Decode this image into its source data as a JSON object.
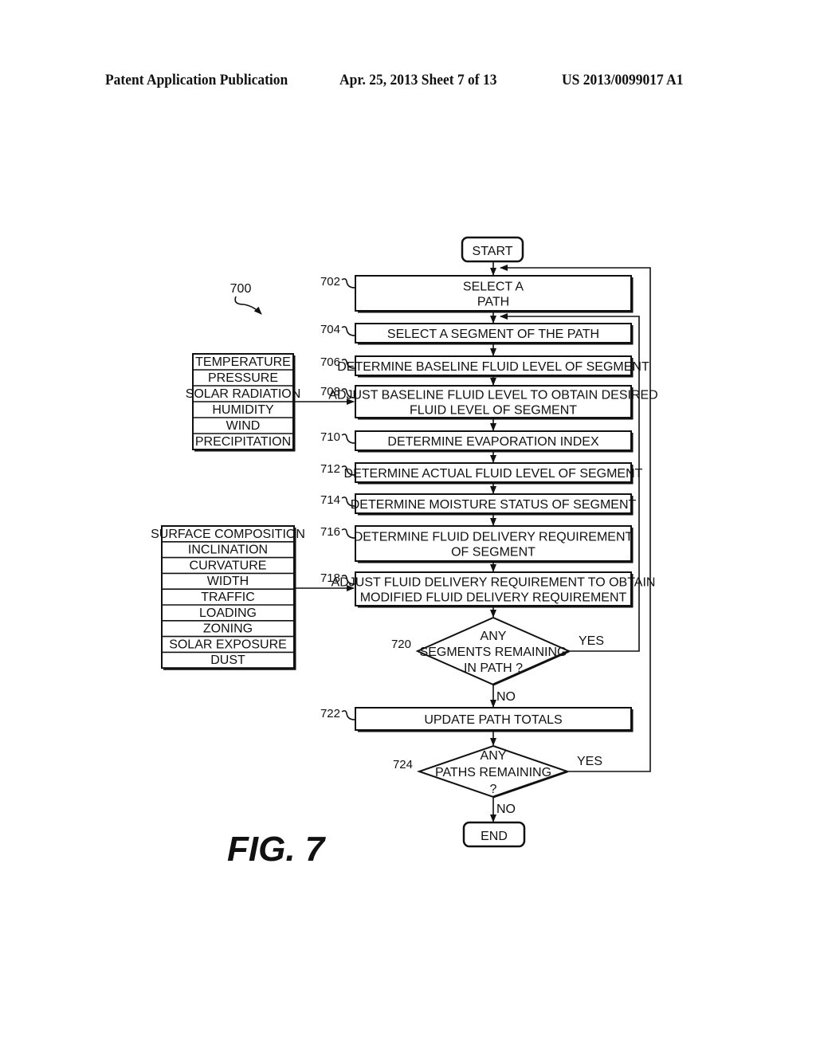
{
  "header": {
    "left": "Patent Application Publication",
    "center": "Apr. 25, 2013  Sheet 7 of 13",
    "right": "US 2013/0099017 A1"
  },
  "figure": {
    "ref": "700",
    "label": "FIG. 7"
  },
  "flow": {
    "start": "START",
    "end": "END",
    "steps": [
      {
        "ref": "702",
        "lines": [
          "SELECT A",
          "PATH"
        ]
      },
      {
        "ref": "704",
        "lines": [
          "SELECT A SEGMENT OF THE PATH"
        ]
      },
      {
        "ref": "706",
        "lines": [
          "DETERMINE BASELINE FLUID LEVEL OF SEGMENT"
        ]
      },
      {
        "ref": "708",
        "lines": [
          "ADJUST BASELINE FLUID LEVEL TO OBTAIN DESIRED",
          "FLUID LEVEL OF SEGMENT"
        ]
      },
      {
        "ref": "710",
        "lines": [
          "DETERMINE EVAPORATION INDEX"
        ]
      },
      {
        "ref": "712",
        "lines": [
          "DETERMINE ACTUAL FLUID LEVEL OF SEGMENT"
        ]
      },
      {
        "ref": "714",
        "lines": [
          "DETERMINE MOISTURE STATUS OF SEGMENT"
        ]
      },
      {
        "ref": "716",
        "lines": [
          "DETERMINE FLUID DELIVERY REQUIREMENT",
          "OF SEGMENT"
        ]
      },
      {
        "ref": "718",
        "lines": [
          "ADJUST FLUID DELIVERY REQUIREMENT TO OBTAIN",
          "MODIFIED FLUID DELIVERY REQUIREMENT"
        ]
      },
      {
        "ref": "722",
        "lines": [
          "UPDATE PATH TOTALS"
        ]
      }
    ],
    "decisions": [
      {
        "ref": "720",
        "lines": [
          "ANY",
          "SEGMENTS REMAINING",
          "IN PATH ?"
        ],
        "yes": "YES",
        "no": "NO"
      },
      {
        "ref": "724",
        "lines": [
          "ANY",
          "PATHS REMAINING",
          "?"
        ],
        "yes": "YES",
        "no": "NO"
      }
    ]
  },
  "weather_factors": [
    "TEMPERATURE",
    "PRESSURE",
    "SOLAR RADIATION",
    "HUMIDITY",
    "WIND",
    "PRECIPITATION"
  ],
  "surface_factors": [
    "SURFACE COMPOSITION",
    "INCLINATION",
    "CURVATURE",
    "WIDTH",
    "TRAFFIC",
    "LOADING",
    "ZONING",
    "SOLAR EXPOSURE",
    "DUST"
  ]
}
